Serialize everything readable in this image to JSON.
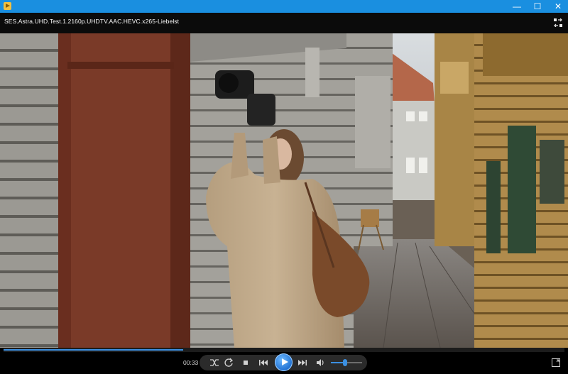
{
  "window": {
    "minimize_glyph": "—",
    "maximize_glyph": "☐",
    "close_glyph": "✕"
  },
  "player": {
    "file_title": "SES.Astra.UHD.Test.1.2160p.UHDTV.AAC.HEVC.x265-Liebelst",
    "elapsed_time": "00:33",
    "seek_progress": 0.32,
    "volume_level": 0.45
  },
  "icons": {
    "app": "media-player-app-icon",
    "layout": "compact-layout-icon",
    "shuffle": "shuffle-icon",
    "repeat": "repeat-icon",
    "stop": "stop-icon",
    "previous": "previous-icon",
    "play": "play-icon",
    "next": "next-icon",
    "volume": "speaker-icon",
    "fullscreen": "fullscreen-icon"
  },
  "colors": {
    "titlebar": "#1a8fe0",
    "accent": "#3b8fe0"
  }
}
